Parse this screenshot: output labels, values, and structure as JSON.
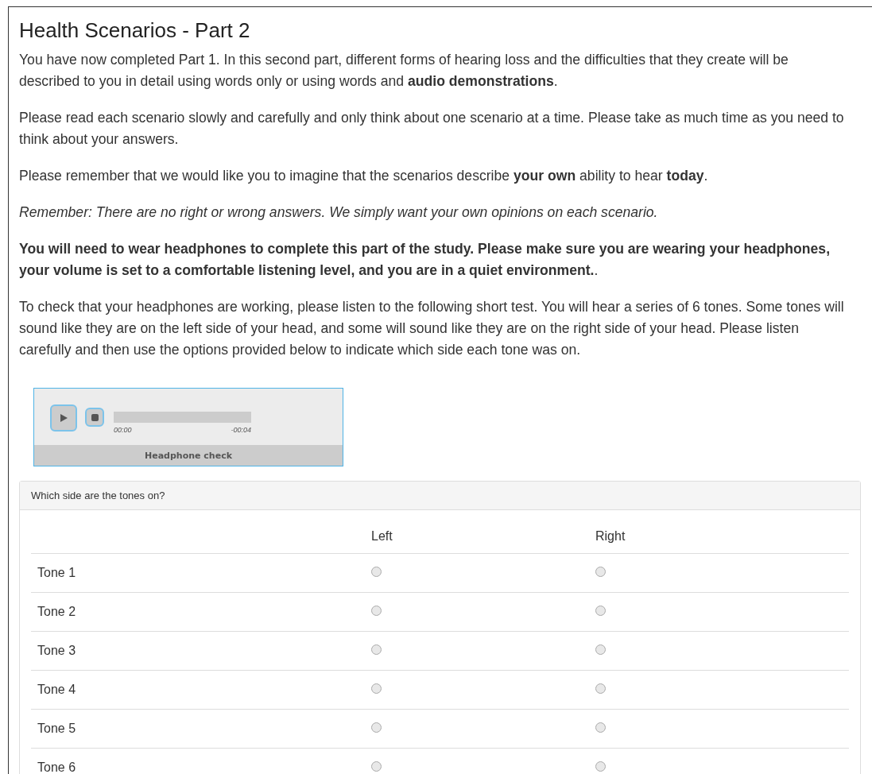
{
  "title": "Health Scenarios - Part 2",
  "paragraphs": [
    {
      "kind": "plain",
      "text": "You have now completed Part 1. In this second part, different forms of hearing loss and the difficulties that they create will be described to you in detail using words only or using words and **audio demonstrations**."
    },
    {
      "kind": "plain",
      "text": "Please read each scenario slowly and carefully and only think about one scenario at a time. Please take as much time as you need to think about your answers."
    },
    {
      "kind": "plain",
      "text": "Please remember that we would like you to imagine that the scenarios describe **your own** ability to hear **today**."
    },
    {
      "kind": "italic",
      "text": "Remember: There are no right or wrong answers. We simply want your own opinions on each scenario."
    },
    {
      "kind": "plain",
      "text": "**You will need to wear headphones to complete this part of the study. Please make sure you are wearing your headphones, your volume is set to a comfortable listening level, and you are in a quiet environment.**."
    },
    {
      "kind": "plain",
      "text": "To check that your headphones are working, please listen to the following short test. You will hear a series of 6 tones. Some tones will sound like they are on the left side of your head, and some will sound like they are on the right side of your head. Please listen carefully and then use the options provided below to indicate which side each tone was on."
    }
  ],
  "player": {
    "elapsed": "00:00",
    "remaining": "-00:04",
    "caption": "Headphone check"
  },
  "question": {
    "title": "Which side are the tones on?",
    "columns": [
      "Left",
      "Right"
    ],
    "rows": [
      {
        "label": "Tone 1",
        "options": [
          {
            "selected": false
          },
          {
            "selected": false
          }
        ]
      },
      {
        "label": "Tone 2",
        "options": [
          {
            "selected": false
          },
          {
            "selected": false
          }
        ]
      },
      {
        "label": "Tone 3",
        "options": [
          {
            "selected": false
          },
          {
            "selected": false
          }
        ]
      },
      {
        "label": "Tone 4",
        "options": [
          {
            "selected": false
          },
          {
            "selected": false
          }
        ]
      },
      {
        "label": "Tone 5",
        "options": [
          {
            "selected": false
          },
          {
            "selected": false
          }
        ]
      },
      {
        "label": "Tone 6",
        "options": [
          {
            "selected": false
          },
          {
            "selected": false
          }
        ]
      }
    ]
  }
}
